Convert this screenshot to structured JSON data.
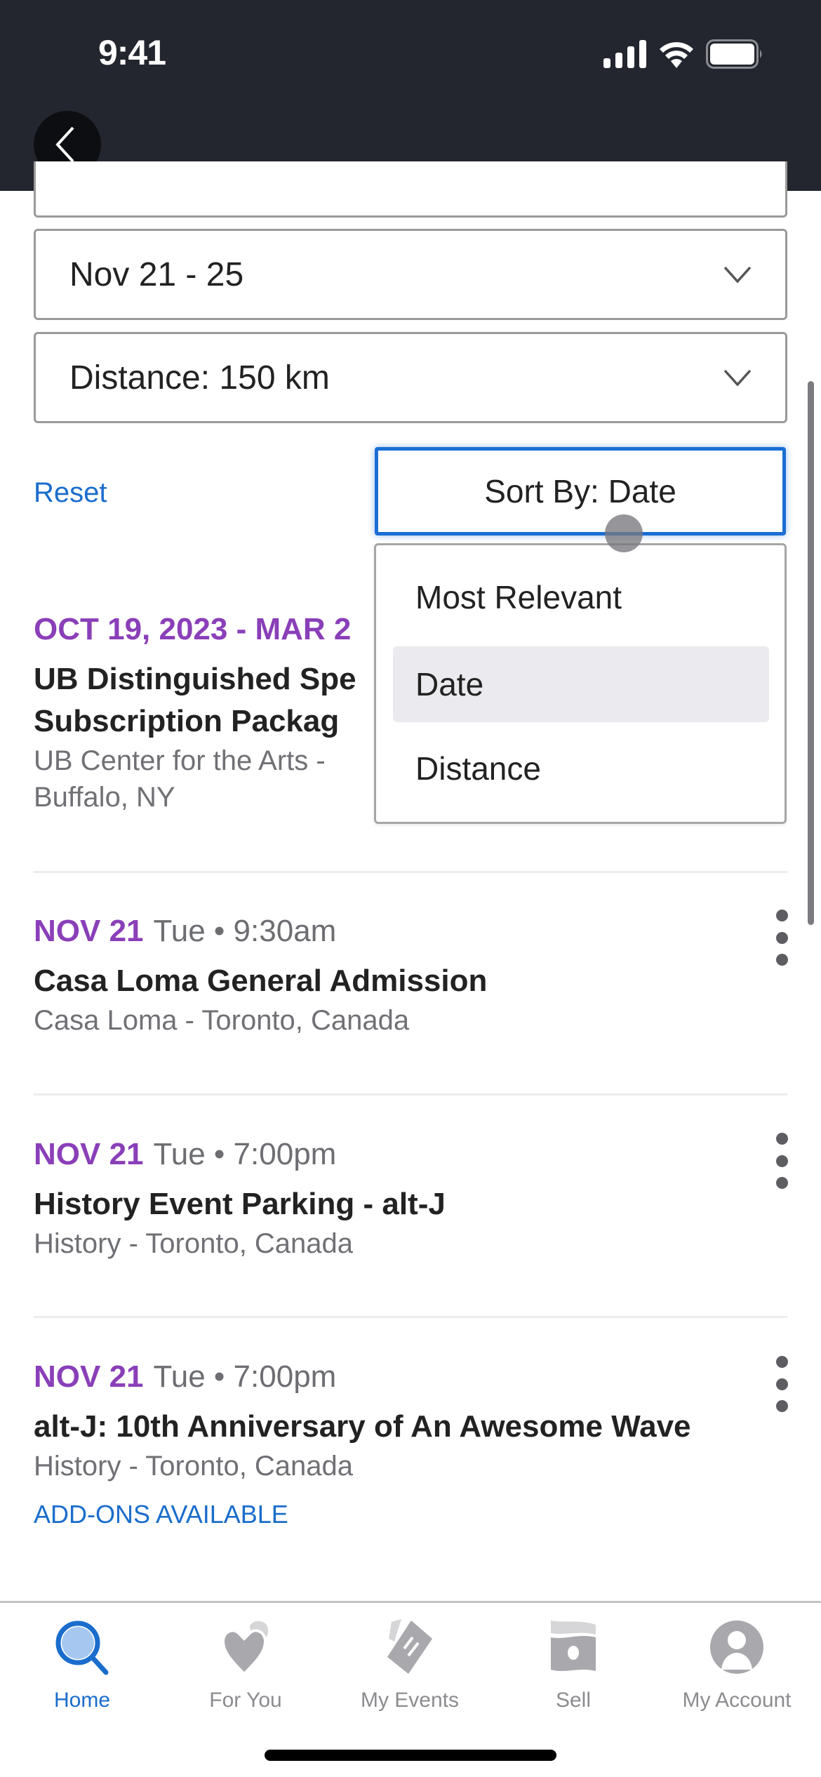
{
  "status_bar": {
    "time": "9:41",
    "icons": [
      "signal-icon",
      "wifi-icon",
      "battery-icon"
    ]
  },
  "header": {
    "back_icon": "chevron-left-icon"
  },
  "filters": {
    "date_range": "Nov 21 - 25",
    "distance": "Distance: 150 km",
    "chevron_icon": "chevron-down-icon"
  },
  "sort": {
    "reset_label": "Reset",
    "button_label": "Sort By: Date",
    "options": [
      {
        "label": "Most Relevant",
        "selected": false
      },
      {
        "label": "Date",
        "selected": true
      },
      {
        "label": "Distance",
        "selected": false
      }
    ]
  },
  "events": [
    {
      "date": "OCT 19, 2023 - MAR 2",
      "time": "",
      "title_line1": "UB Distinguished Spe",
      "title_line2": "Subscription Packag",
      "venue_line1": "UB Center for the Arts -",
      "venue_line2": "Buffalo, NY"
    },
    {
      "date": "NOV 21",
      "time": "Tue • 9:30am",
      "title": "Casa Loma General Admission",
      "venue": "Casa Loma - Toronto, Canada"
    },
    {
      "date": "NOV 21",
      "time": "Tue • 7:00pm",
      "title": "History Event Parking - alt-J",
      "venue": "History - Toronto, Canada"
    },
    {
      "date": "NOV 21",
      "time": "Tue • 7:00pm",
      "title": "alt-J: 10th Anniversary of An Awesome Wave",
      "venue": "History - Toronto, Canada",
      "addons": "ADD-ONS AVAILABLE"
    }
  ],
  "tabbar": {
    "tabs": [
      {
        "label": "Home",
        "icon": "search-icon",
        "active": true
      },
      {
        "label": "For You",
        "icon": "heart-icon",
        "active": false
      },
      {
        "label": "My Events",
        "icon": "ticket-icon",
        "active": false
      },
      {
        "label": "Sell",
        "icon": "cash-icon",
        "active": false
      },
      {
        "label": "My Account",
        "icon": "account-icon",
        "active": false
      }
    ]
  },
  "colors": {
    "accent": "#1a6dcc",
    "date_purple": "#8a3fb8",
    "header_bg": "#23262e"
  }
}
